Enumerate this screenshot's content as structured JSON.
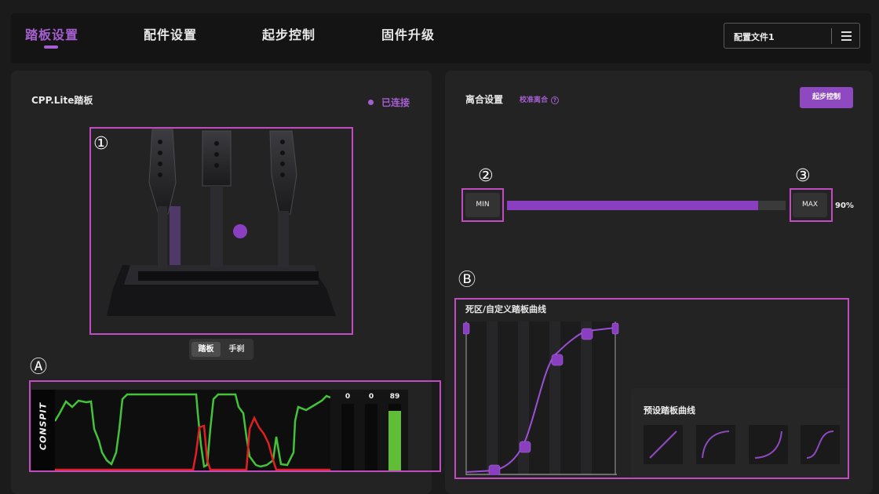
{
  "nav": {
    "tabs": [
      {
        "label": "踏板设置",
        "active": true
      },
      {
        "label": "配件设置",
        "active": false
      },
      {
        "label": "起步控制",
        "active": false
      },
      {
        "label": "固件升级",
        "active": false
      }
    ],
    "profile_label": "配置文件1",
    "menu_icon": "hamburger-menu-icon"
  },
  "left": {
    "title": "CPP.Lite踏板",
    "status": "已连接",
    "segment": [
      "踏板",
      "手刹"
    ],
    "brand": "CONSPIT",
    "bars": [
      {
        "value": "0",
        "level": 0
      },
      {
        "value": "0",
        "level": 0
      },
      {
        "value": "89",
        "level": 0.89
      }
    ]
  },
  "right": {
    "title": "离合设置",
    "calibrate": "校准离合",
    "launch_button": "起步控制",
    "min_label": "MIN",
    "max_label": "MAX",
    "percent": "90%",
    "range_level": 0.9,
    "curve_title": "死区/自定义踏板曲线",
    "preset_title": "预设踏板曲线"
  },
  "annotations": {
    "one": "①",
    "two": "②",
    "three": "③",
    "A": "Ⓐ",
    "B": "Ⓑ"
  },
  "colors": {
    "accent": "#a55fd0",
    "highlight": "#c24bc2",
    "throttle": "#5fbe36",
    "brake": "#e02020"
  }
}
